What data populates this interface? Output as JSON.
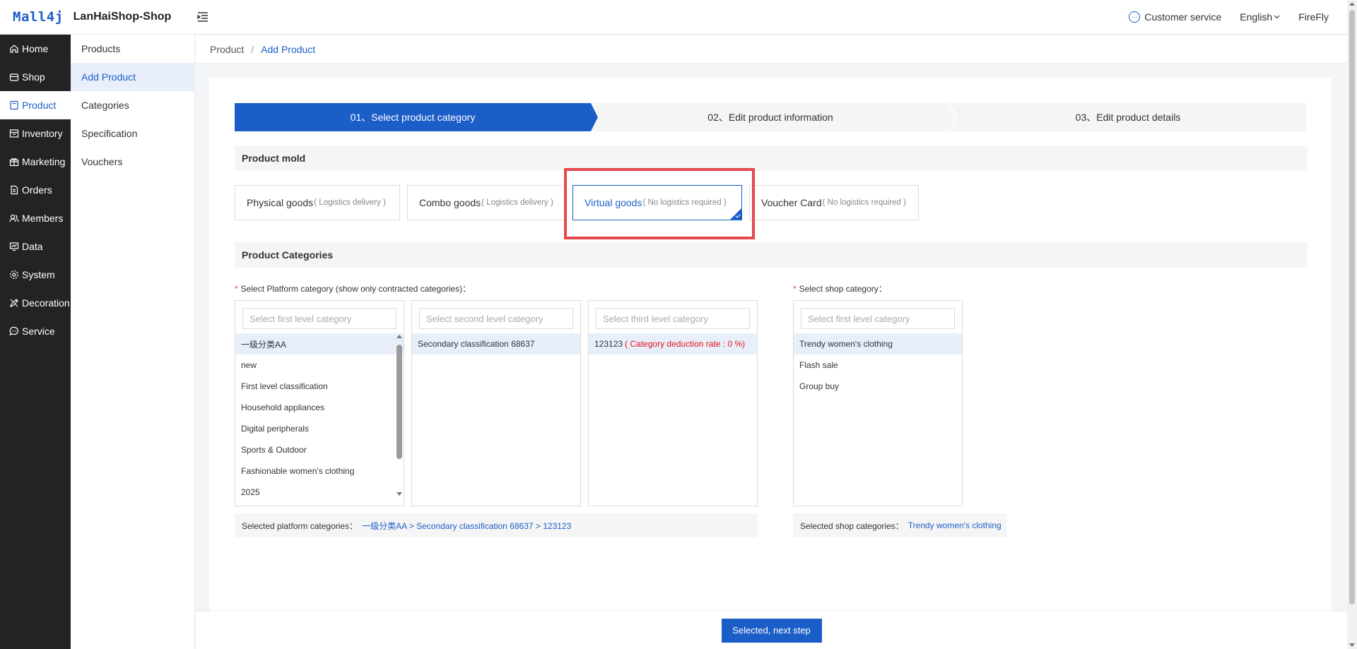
{
  "header": {
    "logo_mark": "Mall4j",
    "shop_name": "LanHaiShop-Shop",
    "customer_service": "Customer service",
    "language": "English",
    "user": "FireFly"
  },
  "sidebar": {
    "items": [
      {
        "label": "Home",
        "icon": "home-icon"
      },
      {
        "label": "Shop",
        "icon": "shop-icon"
      },
      {
        "label": "Product",
        "icon": "product-icon",
        "active": true
      },
      {
        "label": "Inventory",
        "icon": "inventory-icon"
      },
      {
        "label": "Marketing",
        "icon": "marketing-icon"
      },
      {
        "label": "Orders",
        "icon": "orders-icon"
      },
      {
        "label": "Members",
        "icon": "members-icon"
      },
      {
        "label": "Data",
        "icon": "data-icon"
      },
      {
        "label": "System",
        "icon": "system-icon"
      },
      {
        "label": "Decoration",
        "icon": "decoration-icon"
      },
      {
        "label": "Service",
        "icon": "service-icon"
      }
    ]
  },
  "submenu": {
    "items": [
      "Products",
      "Add Product",
      "Categories",
      "Specification",
      "Vouchers"
    ],
    "active_index": 1
  },
  "breadcrumb": {
    "parent": "Product",
    "separator": "/",
    "current": "Add Product"
  },
  "steps": [
    {
      "label": "01、Select product category",
      "active": true
    },
    {
      "label": "02、Edit product information",
      "active": false
    },
    {
      "label": "03、Edit product details",
      "active": false
    }
  ],
  "product_mold": {
    "title": "Product mold",
    "options": [
      {
        "name": "Physical goods",
        "hint": "( Logistics delivery )"
      },
      {
        "name": "Combo goods",
        "hint": "( Logistics delivery )"
      },
      {
        "name": "Virtual goods",
        "hint": "( No logistics required )",
        "selected": true
      },
      {
        "name": "Voucher Card",
        "hint": "( No logistics required )"
      }
    ]
  },
  "categories": {
    "title": "Product Categories",
    "platform_label": "Select Platform category (show only contracted categories)：",
    "shop_label": "Select shop category：",
    "first": {
      "placeholder": "Select first level category",
      "items": [
        "一级分类AA",
        "new",
        "First level classification",
        "Household appliances",
        "Digital peripherals",
        "Sports & Outdoor",
        "Fashionable women's clothing",
        "2025"
      ]
    },
    "second": {
      "placeholder": "Select second level category",
      "items": [
        "Secondary classification 68637"
      ]
    },
    "third": {
      "placeholder": "Select third level category",
      "items": [
        {
          "name": "123123",
          "rate": "( Category deduction rate : 0 %)"
        }
      ]
    },
    "shop": {
      "placeholder": "Select first level category",
      "items": [
        "Trendy women's clothing",
        "Flash sale",
        "Group buy"
      ]
    },
    "selected_platform_label": "Selected platform categories：",
    "selected_platform_path": "一级分类AA >  Secondary classification 68637 >  123123",
    "selected_shop_label": "Selected shop categories：",
    "selected_shop_path": "Trendy women's clothing"
  },
  "footer": {
    "next_button": "Selected, next step"
  },
  "colors": {
    "accent": "#1c5ec8",
    "highlight": "#e5484d",
    "sidebar_bg": "#232323"
  }
}
